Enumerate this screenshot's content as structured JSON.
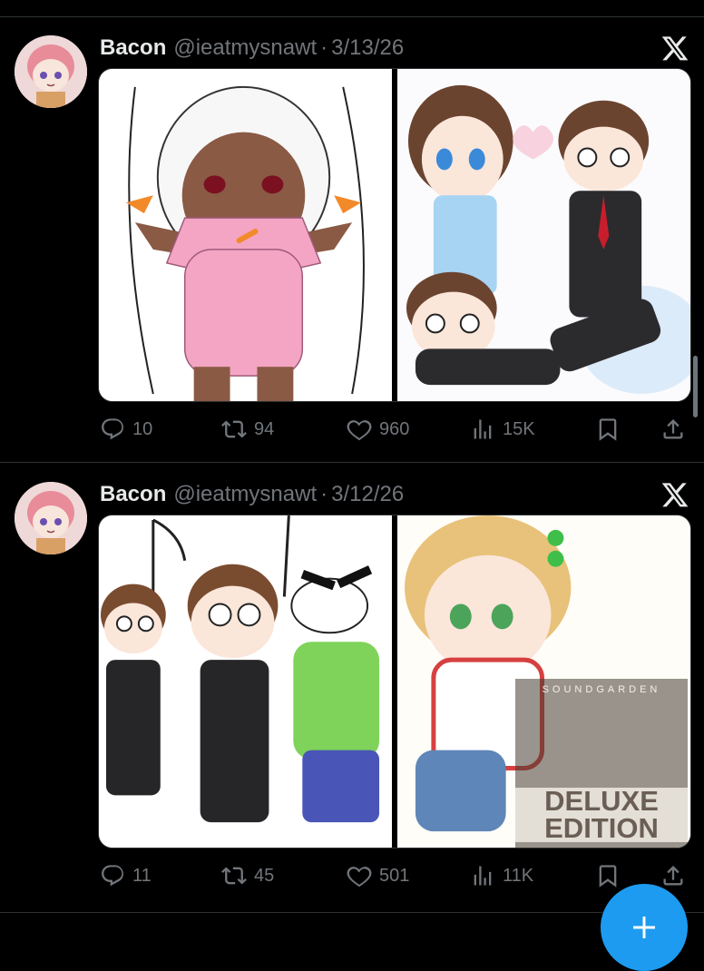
{
  "tweets": [
    {
      "author_name": "Bacon",
      "handle": "@ieatmysnawt",
      "separator": "·",
      "date": "3/13/26",
      "replies": "10",
      "reposts": "94",
      "likes": "960",
      "views": "15K"
    },
    {
      "author_name": "Bacon",
      "handle": "@ieatmysnawt",
      "separator": "·",
      "date": "3/12/26",
      "replies": "11",
      "reposts": "45",
      "likes": "501",
      "views": "11K",
      "album_overlay": {
        "top_text": "SOUNDGARDEN",
        "deluxe_label": "DELUXE EDITION"
      }
    }
  ],
  "icons": {
    "brand": "x-logo-icon",
    "reply": "reply-icon",
    "repost": "repost-icon",
    "like": "heart-icon",
    "views": "views-icon",
    "bookmark": "bookmark-icon",
    "share": "share-icon",
    "compose": "plus-icon"
  },
  "colors": {
    "background": "#000000",
    "text_primary": "#e7e9ea",
    "text_secondary": "#71767b",
    "divider": "#2f3336",
    "accent": "#1d9bf0"
  }
}
